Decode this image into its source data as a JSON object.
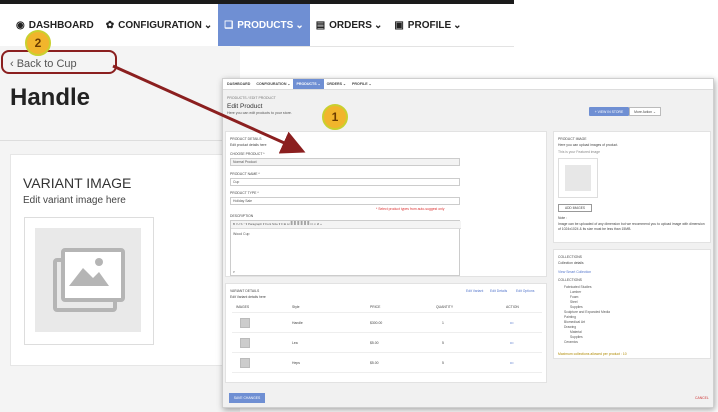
{
  "nav": {
    "items": [
      {
        "label": "DASHBOARD",
        "icon": "dashboard-icon",
        "glyph": "◉"
      },
      {
        "label": "CONFIGURATION",
        "icon": "gear-icon",
        "glyph": "✿",
        "caret": "⌄"
      },
      {
        "label": "PRODUCTS",
        "icon": "tag-icon",
        "glyph": "❑",
        "caret": "⌄",
        "active": true
      },
      {
        "label": "ORDERS",
        "icon": "orders-icon",
        "glyph": "▤",
        "caret": "⌄"
      },
      {
        "label": "PROFILE",
        "icon": "profile-icon",
        "glyph": "▣",
        "caret": "⌄"
      }
    ]
  },
  "background": {
    "back_link": "‹ Back to Cup",
    "page_title": "Handle",
    "variant_image_title": "VARIANT IMAGE",
    "variant_image_subtitle": "Edit variant image here"
  },
  "callouts": {
    "first": "1",
    "second": "2"
  },
  "inset": {
    "nav": [
      "DASHBOARD",
      "CONFIGURATION ⌄",
      "PRODUCTS ⌄",
      "ORDERS ⌄",
      "PROFILE ⌄"
    ],
    "breadcrumb": "PRODUCTS / EDIT PRODUCT",
    "title": "Edit Product",
    "subtitle": "Here you can edit products to your store.",
    "view_button": "+ VIEW IN STORE",
    "more_button": "More Action ⌄",
    "product_details": {
      "heading": "PRODUCT DETAILS",
      "sub": "Edit product details here",
      "choose_product_label": "CHOOSE PRODUCT *",
      "choose_product_value": "Normal Product",
      "product_name_label": "PRODUCT NAME *",
      "product_name_value": "Cup",
      "product_type_label": "PRODUCT TYPE *",
      "product_type_value": "Holiday Sale",
      "product_type_hint": "* Select product types from auto-suggest only",
      "description_label": "DESCRIPTION",
      "toolbar": "B  I  U  S  ⁃ ▾  Paragraph ▾  Font Size ▾  ≡  ⊞  ⊟  ≣  ≣  ≣  ≣  ≣  ≣  ⊡  ∞  ⊘  ‹›",
      "description_value": "Wood Cup",
      "editor_status": "P"
    },
    "product_image": {
      "heading": "PRODUCT IMAGE",
      "sub": "Here you can upload images of product.",
      "note": "This is your Featured image",
      "add_button": "ADD IMAGES",
      "note_heading": "Note :",
      "note_text": "Image can be uploaded of any dimension but we recommend you to upload image with dimension of 1024x1024 & its size must be less than 15MB."
    },
    "collections": {
      "heading": "COLLECTIONS",
      "sub": "Collection details",
      "view_link": "View Smart Collection",
      "list_label": "COLLECTIONS",
      "items": [
        "Fabricated Studies",
        "Lumber",
        "Foam",
        "Steel",
        "Supplies",
        "Sculpture and Expanded Media",
        "Painting",
        "Biomedical Art",
        "Drawing",
        "Material",
        "Supplies",
        "Ceramics"
      ],
      "max_note": "Maximum collections allowed per product : 10"
    },
    "variants": {
      "heading": "VARIANT DETAILS",
      "sub": "Edit Variant details here",
      "actions": [
        "Edit Variant",
        "Edit Details",
        "Edit Options"
      ],
      "columns": [
        "IMAGES",
        "Style",
        "PRICE",
        "QUANTITY",
        "ACTION"
      ],
      "rows": [
        {
          "style": "Handle",
          "price": "$300.00",
          "qty": "1",
          "action": "•••"
        },
        {
          "style": "Lea",
          "price": "$5.00",
          "qty": "5",
          "action": "•••"
        },
        {
          "style": "Heps",
          "price": "$5.00",
          "qty": "5",
          "action": "•••"
        }
      ]
    },
    "save_button": "SAVE CHANGES",
    "cancel_link": "CANCEL"
  }
}
